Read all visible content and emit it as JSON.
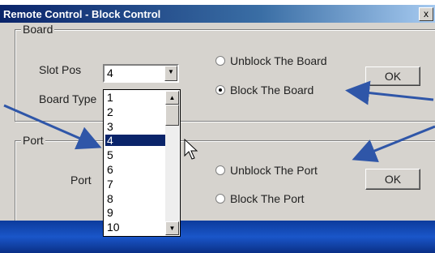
{
  "window": {
    "title": "Remote Control -  Block Control",
    "close_label": "x"
  },
  "board_group": {
    "legend": "Board",
    "slot_pos_label": "Slot Pos",
    "slot_pos_value": "4",
    "board_type_label": "Board Type",
    "radio_unblock": "Unblock The Board",
    "radio_block": "Block The Board",
    "selected": "block",
    "ok_label": "OK"
  },
  "port_group": {
    "legend": "Port",
    "port_label": "Port",
    "radio_unblock": "Unblock The Port",
    "radio_block": "Block The Port",
    "ok_label": "OK"
  },
  "dropdown": {
    "items": [
      "1",
      "2",
      "3",
      "4",
      "5",
      "6",
      "7",
      "8",
      "9",
      "10"
    ],
    "selected_index": 3
  },
  "colors": {
    "annotation_arrow": "#2f56a8",
    "selection": "#0a246a"
  }
}
